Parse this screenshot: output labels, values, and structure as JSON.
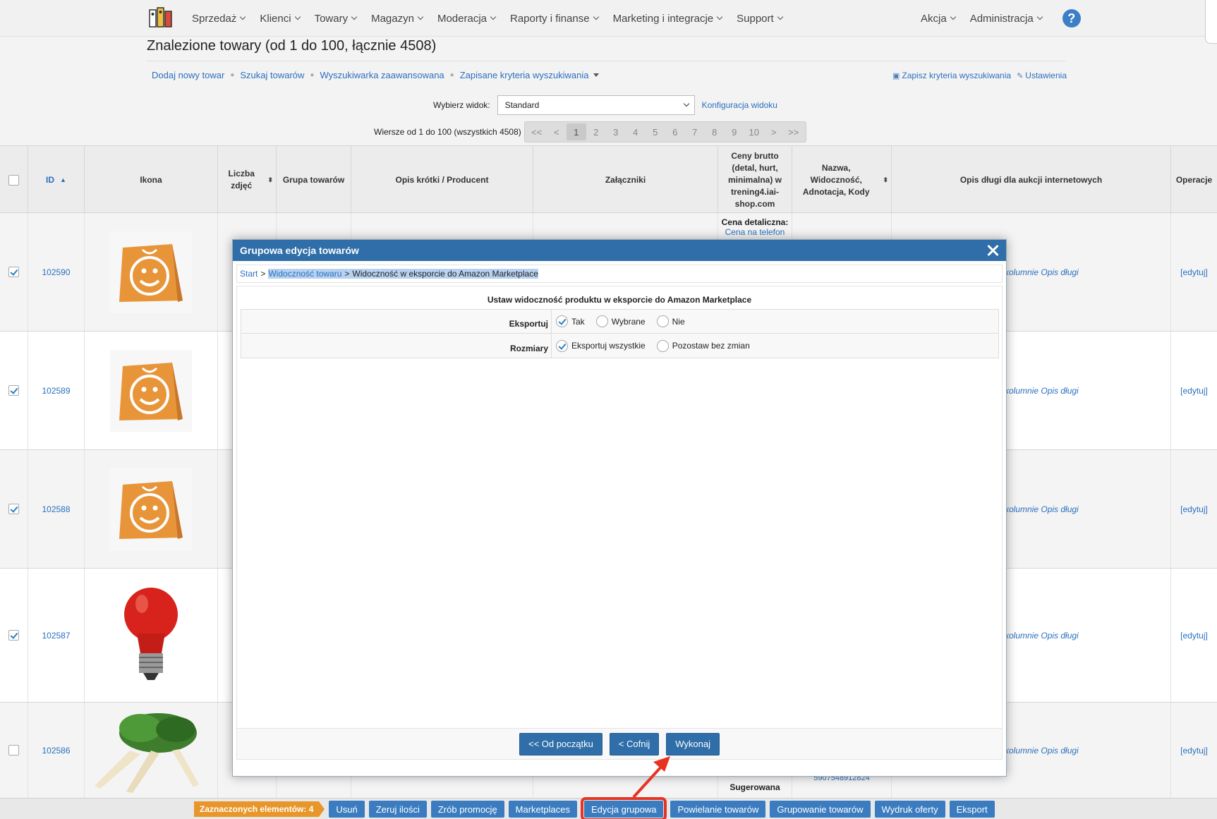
{
  "nav": {
    "items": [
      "Sprzedaż",
      "Klienci",
      "Towary",
      "Magazyn",
      "Moderacja",
      "Raporty i finanse",
      "Marketing i integracje",
      "Support"
    ],
    "right_items": [
      "Akcja",
      "Administracja"
    ],
    "help": "?"
  },
  "page": {
    "title": "Znalezione towary (od 1 do 100, łącznie 4508)",
    "links": [
      "Dodaj nowy towar",
      "Szukaj towarów",
      "Wyszukiwarka zaawansowana",
      "Zapisane kryteria wyszukiwania"
    ],
    "save_criteria": "Zapisz kryteria wyszukiwania",
    "settings": "Ustawienia",
    "view_label": "Wybierz widok:",
    "view_value": "Standard",
    "view_config": "Konfiguracja widoku",
    "rows_info": "Wiersze od 1 do 100 (wszystkich 4508)",
    "pager": [
      "<<",
      "<",
      "1",
      "2",
      "3",
      "4",
      "5",
      "6",
      "7",
      "8",
      "9",
      "10",
      ">",
      ">>"
    ]
  },
  "table": {
    "headers": {
      "id": "ID",
      "icon": "Ikona",
      "photos": "Liczba zdjęć",
      "group": "Grupa towarów",
      "short_desc": "Opis krótki / Producent",
      "attachments": "Załączniki",
      "prices": "Ceny brutto (detal, hurt, minimalna) w trening4.iai-shop.com",
      "name": "Nazwa, Widoczność, Adnotacja, Kody",
      "long_desc": "Opis długi dla aukcji internetowych",
      "ops": "Operacje"
    },
    "rows": [
      {
        "id": "102590",
        "desc": "kolumnie Opis długi",
        "edit": "[edytuj]"
      },
      {
        "id": "102589",
        "desc": "kolumnie Opis długi",
        "edit": "[edytuj]"
      },
      {
        "id": "102588",
        "desc": "kolumnie Opis długi",
        "edit": "[edytuj]"
      },
      {
        "id": "102587",
        "desc": "kolumnie Opis długi",
        "edit": "[edytuj]"
      },
      {
        "id": "102586",
        "desc": "kolumnie Opis długi",
        "edit": "[edytuj]"
      }
    ],
    "price_label": "Cena detaliczna:",
    "price_value": "Cena na telefon",
    "suggested_label": "Sugerowana",
    "ean": "5907548912824"
  },
  "modal": {
    "title": "Grupowa edycja towarów",
    "crumb_start": "Start",
    "crumb_sep": ">",
    "crumb_mid": "Widoczność towaru",
    "crumb_last": "Widoczność w eksporcie do Amazon Marketplace",
    "form_title": "Ustaw widoczność produktu w eksporcie do Amazon Marketplace",
    "export_label": "Eksportuj",
    "export_opts": [
      "Tak",
      "Wybrane",
      "Nie"
    ],
    "sizes_label": "Rozmiary",
    "sizes_opts": [
      "Eksportuj wszystkie",
      "Pozostaw bez zmian"
    ],
    "btn_start": "<< Od początku",
    "btn_back": "< Cofnij",
    "btn_exec": "Wykonaj"
  },
  "bottom": {
    "count": "Zaznaczonych elementów: 4",
    "buttons": [
      "Usuń",
      "Zeruj ilości",
      "Zrób promocję",
      "Marketplaces",
      "Edycja grupowa",
      "Powielanie towarów",
      "Grupowanie towarów",
      "Wydruk oferty",
      "Eksport"
    ]
  },
  "colors": {
    "primary": "#2f6ea8",
    "link": "#2a6fbf",
    "badge": "#e8962a",
    "highlight": "#e63322"
  }
}
